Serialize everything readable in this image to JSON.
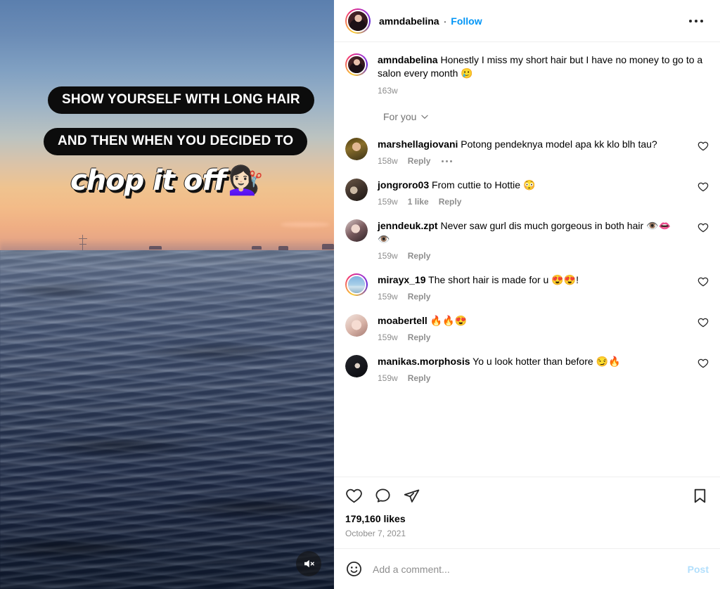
{
  "post": {
    "author": "amndabelina",
    "separator": "·",
    "follow_label": "Follow",
    "more_icon": "ellipsis-icon",
    "caption": {
      "username": "amndabelina",
      "text": " Honestly I miss my short hair but I have no money to go to a salon every month 🥲",
      "time": "163w"
    },
    "filter": {
      "label": "For you",
      "icon": "chevron-down-icon"
    }
  },
  "comments": [
    {
      "username": "marshellagiovani",
      "text": " Potong pendeknya model apa kk klo blh tau?",
      "time": "158w",
      "likes": "",
      "reply": "Reply",
      "has_dots": true,
      "avatar": "face-b",
      "ring": false
    },
    {
      "username": "jongroro03",
      "text": " From cuttie to Hottie 😳",
      "time": "159w",
      "likes": "1 like",
      "reply": "Reply",
      "has_dots": false,
      "avatar": "face-c",
      "ring": false
    },
    {
      "username": "jenndeuk.zpt",
      "text": " Never saw gurl dis much gorgeous in both hair 👁️👄👁️",
      "time": "159w",
      "likes": "",
      "reply": "Reply",
      "has_dots": false,
      "avatar": "face-d",
      "ring": false
    },
    {
      "username": "mirayx_19",
      "text": " The short hair is made for u 😍😍!",
      "time": "159w",
      "likes": "",
      "reply": "Reply",
      "has_dots": false,
      "avatar": "face-e",
      "ring": true
    },
    {
      "username": "moabertell",
      "text": " 🔥🔥😍",
      "time": "159w",
      "likes": "",
      "reply": "Reply",
      "has_dots": false,
      "avatar": "face-f",
      "ring": false
    },
    {
      "username": "manikas.morphosis",
      "text": " Yo u look hotter than before 😏🔥",
      "time": "159w",
      "likes": "",
      "reply": "Reply",
      "has_dots": false,
      "avatar": "face-g",
      "ring": false
    }
  ],
  "actions": {
    "like_icon": "heart-icon",
    "comment_icon": "speech-bubble-icon",
    "share_icon": "paper-plane-icon",
    "save_icon": "bookmark-icon",
    "likes_count": "179,160 likes",
    "post_date": "October 7, 2021"
  },
  "add_comment": {
    "emoji_icon": "smiley-face-icon",
    "placeholder": "Add a comment...",
    "value": "",
    "post_label": "Post"
  },
  "video": {
    "overlay_line1": "SHOW YOURSELF WITH LONG HAIR",
    "overlay_line2": "AND THEN WHEN YOU  DECIDED TO",
    "overlay_line3": "chop it off",
    "overlay_emoji": "💇🏻‍♀️",
    "mute_icon": "speaker-muted-icon"
  },
  "colors": {
    "accent_blue": "#0095f6",
    "muted_gray": "#8e8e8e",
    "post_disabled": "#b2dffc",
    "divider": "#efefef"
  }
}
